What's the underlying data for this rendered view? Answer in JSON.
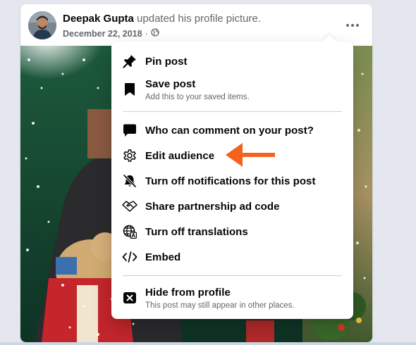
{
  "post": {
    "author": "Deepak Gupta",
    "action": "updated his profile picture.",
    "date": "December 22, 2018",
    "separator": "·",
    "privacy_icon": "globe-icon",
    "more_icon": "more-dots-icon"
  },
  "menu": {
    "items": [
      {
        "label": "Pin post",
        "icon": "pin-icon"
      },
      {
        "label": "Save post",
        "sub": "Add this to your saved items.",
        "icon": "bookmark-icon"
      },
      {
        "label": "Who can comment on your post?",
        "icon": "comment-icon"
      },
      {
        "label": "Edit audience",
        "icon": "gear-icon"
      },
      {
        "label": "Turn off notifications for this post",
        "icon": "bell-off-icon"
      },
      {
        "label": "Share partnership ad code",
        "icon": "handshake-icon"
      },
      {
        "label": "Turn off translations",
        "icon": "globe-translate-icon"
      },
      {
        "label": "Embed",
        "icon": "code-icon"
      },
      {
        "label": "Hide from profile",
        "sub": "This post may still appear in other places.",
        "icon": "hide-icon"
      }
    ]
  },
  "annotation": {
    "type": "arrow",
    "color": "#f4621f",
    "points_to": "Edit audience"
  },
  "colors": {
    "text": "#050505",
    "secondary": "#65676b",
    "divider": "#ced0d4",
    "background": "#e4e8ee"
  }
}
